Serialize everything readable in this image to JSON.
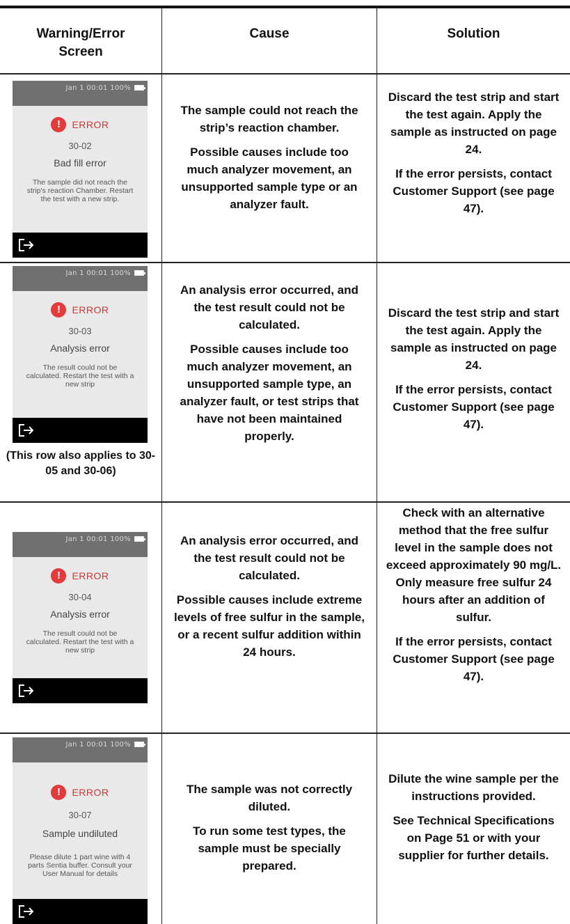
{
  "headers": {
    "screen": "Warning/Error Screen",
    "cause": "Cause",
    "solution": "Solution"
  },
  "rows": [
    {
      "screen": {
        "status": "Jan 1 00:01 100%",
        "error_label": "ERROR",
        "code": "30-02",
        "title": "Bad fill error",
        "message": "The sample did not reach the strip's reaction Chamber. Restart the test with a new strip."
      },
      "note": "",
      "cause": [
        "The sample could not reach the strip’s reaction chamber.",
        "Possible causes include too much analyzer movement, an unsupported sample type or an analyzer fault."
      ],
      "solution": [
        "Discard the test strip and start the test again. Apply the sample as instructed on page 24.",
        "If the error persists, contact Customer Support (see page 47)."
      ]
    },
    {
      "screen": {
        "status": "Jan 1 00:01 100%",
        "error_label": "ERROR",
        "code": "30-03",
        "title": "Analysis error",
        "message": "The result could not be calculated. Restart the test with a new strip"
      },
      "note": "(This row also applies to 30-05 and 30-06)",
      "cause": [
        "An analysis error occurred, and the test result could not be calculated.",
        "Possible causes include too much analyzer movement, an unsupported sample type, an analyzer fault, or test strips that have not been maintained properly."
      ],
      "solution": [
        "Discard the test strip and start the test again. Apply the sample as instructed on page 24.",
        "If the error persists, contact Customer Support (see page 47)."
      ]
    },
    {
      "screen": {
        "status": "Jan 1 00:01 100%",
        "error_label": "ERROR",
        "code": "30-04",
        "title": "Analysis error",
        "message": "The result could not be calculated. Restart the test with a new strip"
      },
      "note": "",
      "cause": [
        "An analysis error occurred, and the test result could not be calculated.",
        "Possible causes include extreme levels of free sulfur in the sample, or a recent sulfur addition within 24 hours."
      ],
      "solution": [
        "Check with an alternative method that the free sulfur level in the sample does not exceed approximately 90 mg/L. Only measure free sulfur 24 hours after an addition of sulfur.",
        "If the error persists, contact Customer Support (see page 47)."
      ]
    },
    {
      "screen": {
        "status": "Jan 1 00:01 100%",
        "error_label": "ERROR",
        "code": "30-07",
        "title": "Sample undiluted",
        "message": "Please dilute 1 part wine with 4 parts Sentia buffer. Consult your User Manual for details"
      },
      "note": "",
      "cause": [
        "The sample was not correctly diluted.",
        "To run some test types, the sample must be specially prepared."
      ],
      "solution": [
        "Dilute the wine sample per the instructions provided.",
        "See Technical Specifications on Page 51 or with your supplier for further details."
      ]
    }
  ]
}
